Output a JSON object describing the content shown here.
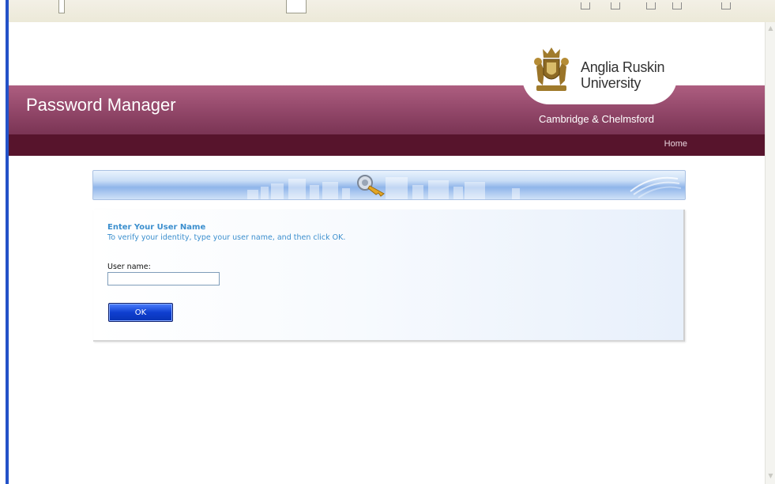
{
  "header": {
    "app_title": "Password Manager",
    "university": {
      "line1": "Anglia Ruskin",
      "line2": "University"
    },
    "tagline": "Cambridge & Chelmsford",
    "nav": {
      "home": "Home"
    }
  },
  "form": {
    "title": "Enter Your User Name",
    "instructions": "To verify your identity, type your user name, and then click OK.",
    "username_label": "User name:",
    "username_value": "",
    "ok_label": "OK"
  },
  "colors": {
    "maroon": "#93486a",
    "navbar": "#57142c",
    "accent_blue": "#3c8fce",
    "button_blue": "#0f3fd0"
  }
}
